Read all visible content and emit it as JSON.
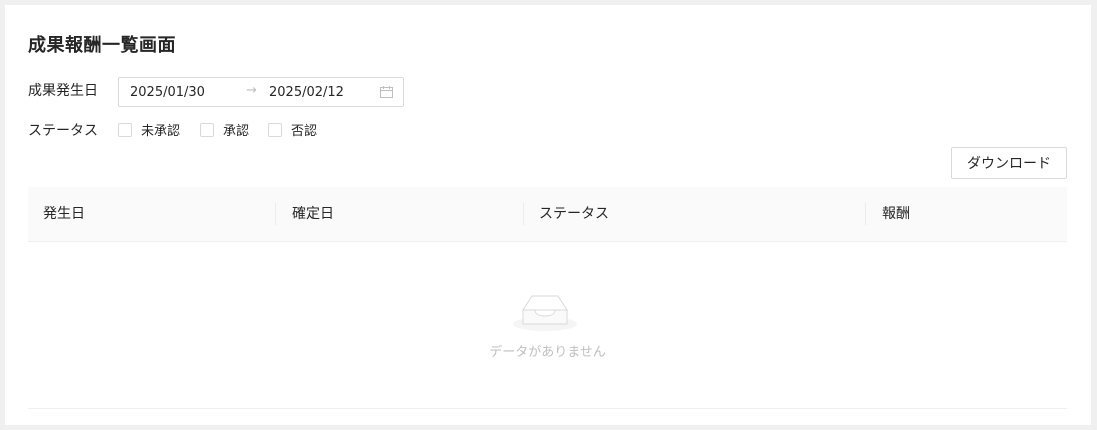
{
  "page": {
    "title": "成果報酬一覧画面"
  },
  "filters": {
    "date_label": "成果発生日",
    "date_start": "2025/01/30",
    "date_separator": "→",
    "date_end": "2025/02/12",
    "date_icon": "calendar-icon",
    "status_label": "ステータス",
    "status_options": [
      {
        "label": "未承認",
        "checked": false
      },
      {
        "label": "承認",
        "checked": false
      },
      {
        "label": "否認",
        "checked": false
      }
    ]
  },
  "toolbar": {
    "download_label": "ダウンロード"
  },
  "table": {
    "columns": [
      "発生日",
      "確定日",
      "ステータス",
      "報酬"
    ],
    "rows": [],
    "empty_text": "データがありません",
    "empty_icon": "empty-inbox-icon"
  }
}
